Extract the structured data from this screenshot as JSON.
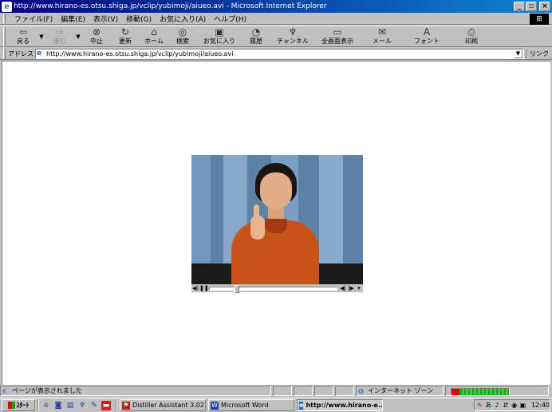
{
  "window": {
    "title": "http://www.hirano-es.otsu.shiga.jp/vclip/yubimoji/aiueo.avi - Microsoft Internet Explorer",
    "minimize": "_",
    "maximize": "▫",
    "close": "×"
  },
  "menu": {
    "items": [
      "ファイル(F)",
      "編集(E)",
      "表示(V)",
      "移動(G)",
      "お気に入り(A)",
      "ヘルプ(H)"
    ]
  },
  "toolbar": {
    "back": "戻る",
    "forward": "進む",
    "stop": "中止",
    "refresh": "更新",
    "home": "ホーム",
    "search": "検索",
    "favorites": "お気に入り",
    "history": "履歴",
    "channels": "チャンネル",
    "fullscreen": "全画面表示",
    "mail": "メール",
    "fonts": "フォント",
    "print": "印刷"
  },
  "address": {
    "label": "アドレス",
    "url": "http://www.hirano-es.otsu.shiga.jp/vclip/yubimoji/aiueo.avi",
    "links": "リンク"
  },
  "media_player": {
    "progress": 0.2
  },
  "status": {
    "message": "ページが表示されました",
    "zone": "インターネット ゾーン"
  },
  "taskbar": {
    "start": "ｽﾀｰﾄ",
    "tasks": [
      {
        "label": "Distiller Assistant 3.02"
      },
      {
        "label": "Microsoft Word"
      },
      {
        "label": "http://www.hirano-e..."
      }
    ],
    "clock": "12:40"
  }
}
